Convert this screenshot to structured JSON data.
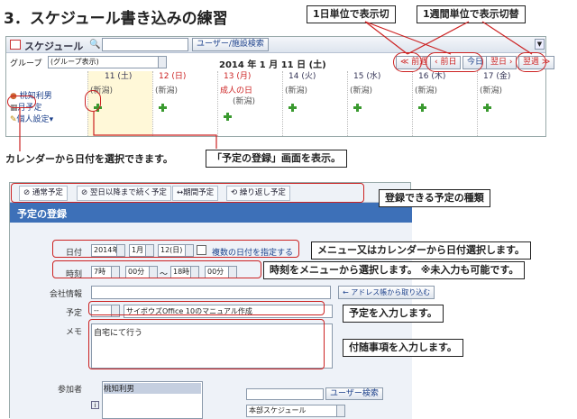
{
  "page_title": "3．スケジュール書き込みの練習",
  "callouts": {
    "day_view": "1日単位で表示切",
    "week_view": "1週間単位で表示切替",
    "calendar_select": "カレンダーから日付を選択できます。",
    "registration_screen": "「予定の登録」画面を表示。",
    "event_types": "登録できる予定の種類",
    "date_select": "メニュー又はカレンダーから日付選択します。",
    "time_select": "時刻をメニューから選択します。 ※未入力も可能です。",
    "enter_schedule": "予定を入力します。",
    "enter_memo": "付随事項を入力します。"
  },
  "calendar": {
    "app_title": "スケジュール",
    "user_search": "ユーザー/施設検索",
    "group_label": "グループ",
    "group_value": "(グループ表示)",
    "current_date": "2014 年 1 月 11 日 (土)",
    "nav": {
      "prev_week": "≪ 前週",
      "prev_day": "‹ 前日",
      "today": "今日",
      "next_day": "翌日 ›",
      "next_week": "翌週 ≫"
    },
    "user_name": "桃知利男",
    "month_view": "月予定",
    "personal_setting": "個人設定",
    "days": [
      {
        "label": "11 (土)",
        "status": "(新潟)"
      },
      {
        "label": "12 (日)",
        "status": "(新潟)"
      },
      {
        "label": "13 (月)",
        "status": "成人の日"
      },
      {
        "label": "14 (火)",
        "status": "(新潟)"
      },
      {
        "label": "15 (水)",
        "status": "(新潟)"
      },
      {
        "label": "16 (木)",
        "status": "(新潟)"
      },
      {
        "label": "17 (金)",
        "status": "(新潟)"
      }
    ],
    "extra_status": "(新潟)"
  },
  "form": {
    "tabs": [
      "通常予定",
      "翌日以降まで続く予定",
      "期間予定",
      "繰り返し予定"
    ],
    "header": "予定の登録",
    "date_label": "日付",
    "year": "2014年",
    "month": "1月",
    "day": "12(日)",
    "multi_date_link": "複数の日付を指定する",
    "time_label": "時刻",
    "start_hour": "7時",
    "start_min": "00分",
    "tilde": "〜",
    "end_hour": "18時",
    "end_min": "00分",
    "company_label": "会社情報",
    "address_button": "← アドレス帳から取り込む",
    "schedule_label": "予定",
    "schedule_type": "--",
    "schedule_title": "サイボウズOffice 10のマニュアル作成",
    "memo_label": "メモ",
    "memo_text": "自宅にて行う",
    "participants_label": "参加者",
    "participant": "桃知利男",
    "user_search": "ユーザー検索",
    "group_select": "本部スケジュール"
  },
  "colors": {
    "header_blue": "#3d70b8",
    "red": "#cc2222",
    "green": "#3a9a2f"
  }
}
